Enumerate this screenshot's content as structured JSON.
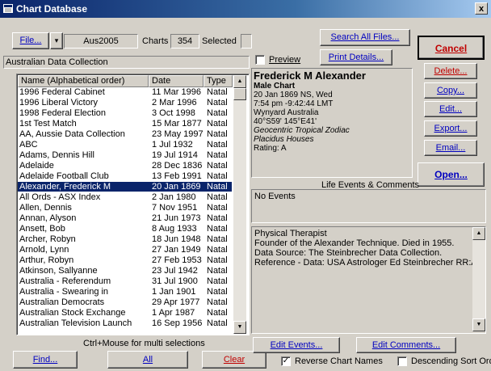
{
  "window": {
    "title": "Chart Database",
    "close_label": "x"
  },
  "toolbar": {
    "file_label": "File...",
    "file_dropdown": "▾",
    "file_name": "Aus2005",
    "charts_label": "Charts",
    "charts_count": "354",
    "selected_label": "Selected",
    "selected_count": ""
  },
  "collection_name": "Australian Data Collection",
  "list": {
    "columns": [
      "Name (Alphabetical order)",
      "Date",
      "Type"
    ],
    "rows": [
      [
        "1996 Federal Cabinet",
        "11 Mar 1996",
        "Natal"
      ],
      [
        "1996 Liberal Victory",
        "2 Mar 1996",
        "Natal"
      ],
      [
        "1998 Federal Election",
        "3 Oct 1998",
        "Natal"
      ],
      [
        "1st Test Match",
        "15 Mar 1877",
        "Natal"
      ],
      [
        "AA, Aussie Data Collection",
        "23 May 1997",
        "Natal"
      ],
      [
        "ABC",
        "1 Jul 1932",
        "Natal"
      ],
      [
        "Adams, Dennis Hill",
        "19 Jul 1914",
        "Natal"
      ],
      [
        "Adelaide",
        "28 Dec 1836",
        "Natal"
      ],
      [
        "Adelaide Football Club",
        "13 Feb 1991",
        "Natal"
      ],
      [
        "Alexander, Frederick M",
        "20 Jan 1869",
        "Natal"
      ],
      [
        "All Ords - ASX Index",
        "2 Jan 1980",
        "Natal"
      ],
      [
        "Allen, Dennis",
        "7 Nov 1951",
        "Natal"
      ],
      [
        "Annan, Alyson",
        "21 Jun 1973",
        "Natal"
      ],
      [
        "Ansett, Bob",
        "8 Aug 1933",
        "Natal"
      ],
      [
        "Archer, Robyn",
        "18 Jun 1948",
        "Natal"
      ],
      [
        "Arnold, Lynn",
        "27 Jan 1949",
        "Natal"
      ],
      [
        "Arthur, Robyn",
        "27 Feb 1953",
        "Natal"
      ],
      [
        "Atkinson, Sallyanne",
        "23 Jul 1942",
        "Natal"
      ],
      [
        "Australia - Referendum",
        "31 Jul 1900",
        "Natal"
      ],
      [
        "Australia - Swearing in",
        "1 Jan 1901",
        "Natal"
      ],
      [
        "Australian Democrats",
        "29 Apr 1977",
        "Natal"
      ],
      [
        "Australian Stock Exchange",
        "1 Apr 1987",
        "Natal"
      ],
      [
        "Australian Television Launch",
        "16 Sep 1956",
        "Natal"
      ]
    ],
    "selected_index": 9
  },
  "hint": "Ctrl+Mouse for multi selections",
  "bottom_buttons": {
    "find": "Find...",
    "all": "All",
    "clear": "Clear"
  },
  "options": {
    "reverse_names": "Reverse Chart Names",
    "descending_sort": "Descending Sort Ord",
    "preview": "Preview"
  },
  "right_buttons": {
    "search_all": "Search All Files...",
    "print_details": "Print Details...",
    "cancel": "Cancel",
    "delete": "Delete...",
    "copy": "Copy...",
    "edit": "Edit...",
    "export": "Export...",
    "email": "Email...",
    "open": "Open...",
    "edit_events": "Edit Events...",
    "edit_comments": "Edit Comments..."
  },
  "chart_info": {
    "name": "Frederick M Alexander",
    "chart_type": "Male Chart",
    "date_line": "20 Jan 1869 NS, Wed",
    "time_line": "7:54 pm  -9:42:44 LMT",
    "place": "Wynyard Australia",
    "coords": "40°S59' 145°E41'",
    "zodiac": "Geocentric Tropical Zodiac",
    "houses": "Placidus Houses",
    "rating": "Rating: A"
  },
  "events": {
    "header": "Life Events & Comments",
    "text": "No Events"
  },
  "comments": {
    "lines": [
      "Physical Therapist",
      "Founder of the Alexander Technique. Died in 1955.",
      "Data Source: The Steinbrecher Data Collection.",
      "Reference - Data: USA Astrologer Ed Steinbrecher RR:A"
    ]
  },
  "colors": {
    "title_start": "#0a246a",
    "selection": "#0a246a",
    "accent_blue": "#0000c0",
    "accent_red": "#c00000"
  }
}
